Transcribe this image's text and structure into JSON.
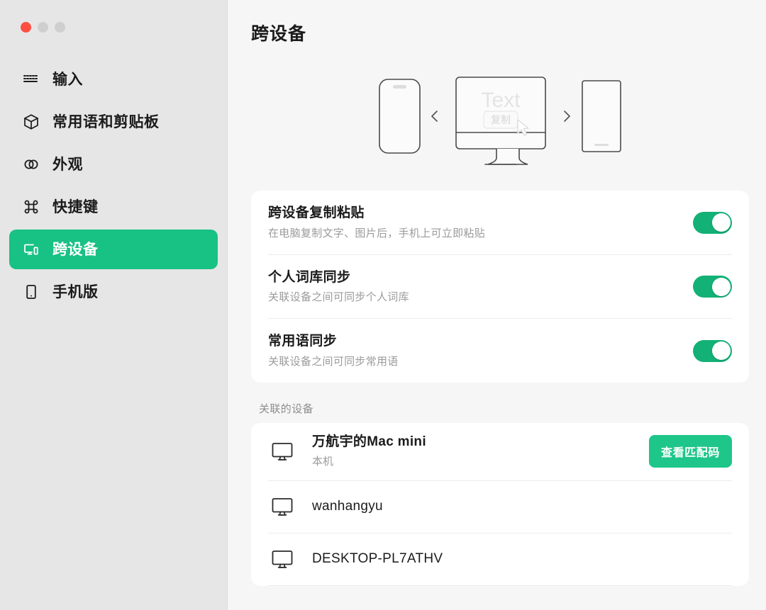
{
  "window": {
    "controls": [
      {
        "name": "close",
        "color": "#fc4f42"
      },
      {
        "name": "minimize",
        "color": "#cfcfcf"
      },
      {
        "name": "maximize",
        "color": "#cfcfcf"
      }
    ]
  },
  "sidebar": {
    "items": [
      {
        "label": "输入",
        "icon": "keyboard-icon",
        "active": false
      },
      {
        "label": "常用语和剪贴板",
        "icon": "cube-icon",
        "active": false
      },
      {
        "label": "外观",
        "icon": "rings-icon",
        "active": false
      },
      {
        "label": "快捷键",
        "icon": "command-icon",
        "active": false
      },
      {
        "label": "跨设备",
        "icon": "cross-device-icon",
        "active": true
      },
      {
        "label": "手机版",
        "icon": "phone-icon",
        "active": false
      }
    ],
    "active_color": "#18c184",
    "background": "#e6e6e6"
  },
  "main": {
    "title": "跨设备",
    "hero": {
      "screen_text": "Text",
      "copy_chip": "复制",
      "left_arrow": "‹",
      "right_arrow": "›"
    },
    "settings": [
      {
        "title": "跨设备复制粘贴",
        "desc": "在电脑复制文字、图片后，手机上可立即粘贴",
        "toggle": "on"
      },
      {
        "title": "个人词库同步",
        "desc": "关联设备之间可同步个人词库",
        "toggle": "on"
      },
      {
        "title": "常用语同步",
        "desc": "关联设备之间可同步常用语",
        "toggle": "on"
      }
    ],
    "devices_section": {
      "label": "关联的设备",
      "devices": [
        {
          "name": "万航宇的Mac mini",
          "sub": "本机",
          "action_label": "查看匹配码",
          "icon": "monitor-icon"
        },
        {
          "name": "wanhangyu",
          "sub": "",
          "action_label": "",
          "icon": "monitor-icon"
        },
        {
          "name": "DESKTOP-PL7ATHV",
          "sub": "",
          "action_label": "",
          "icon": "monitor-icon"
        }
      ]
    }
  },
  "colors": {
    "accent_green": "#13b176",
    "button_green": "#1ec68a",
    "sidebar_active": "#18c184",
    "page_bg": "#f6f6f6",
    "card_bg": "#ffffff",
    "text_primary": "#1b1b1b",
    "text_secondary": "#9b9b9b"
  }
}
